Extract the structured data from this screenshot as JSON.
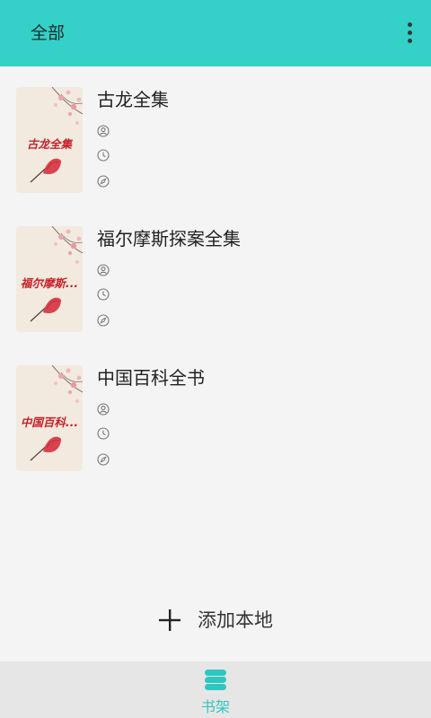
{
  "header": {
    "title": "全部",
    "menu_icon": "more-vertical-icon"
  },
  "books": [
    {
      "name": "古龙全集",
      "cover_title": "古龙全集",
      "author": "",
      "last_read": "",
      "source": ""
    },
    {
      "name": "福尔摩斯探案全集",
      "cover_title": "福尔摩斯...",
      "author": "",
      "last_read": "",
      "source": ""
    },
    {
      "name": "中国百科全书",
      "cover_title": "中国百科...",
      "author": "",
      "last_read": "",
      "source": ""
    }
  ],
  "meta_icons": [
    "person-icon",
    "clock-icon",
    "compass-icon"
  ],
  "add_local": {
    "label": "添加本地",
    "icon": "plus-icon"
  },
  "bottom_nav": {
    "items": [
      {
        "label": "书架",
        "icon": "bookshelf-icon",
        "active": true
      }
    ]
  },
  "colors": {
    "header_bg": "#35d0c8",
    "accent": "#2ec7bf",
    "page_bg": "#f4f4f4",
    "nav_bg": "#e6e6e6",
    "cover_title": "#c8202a"
  }
}
